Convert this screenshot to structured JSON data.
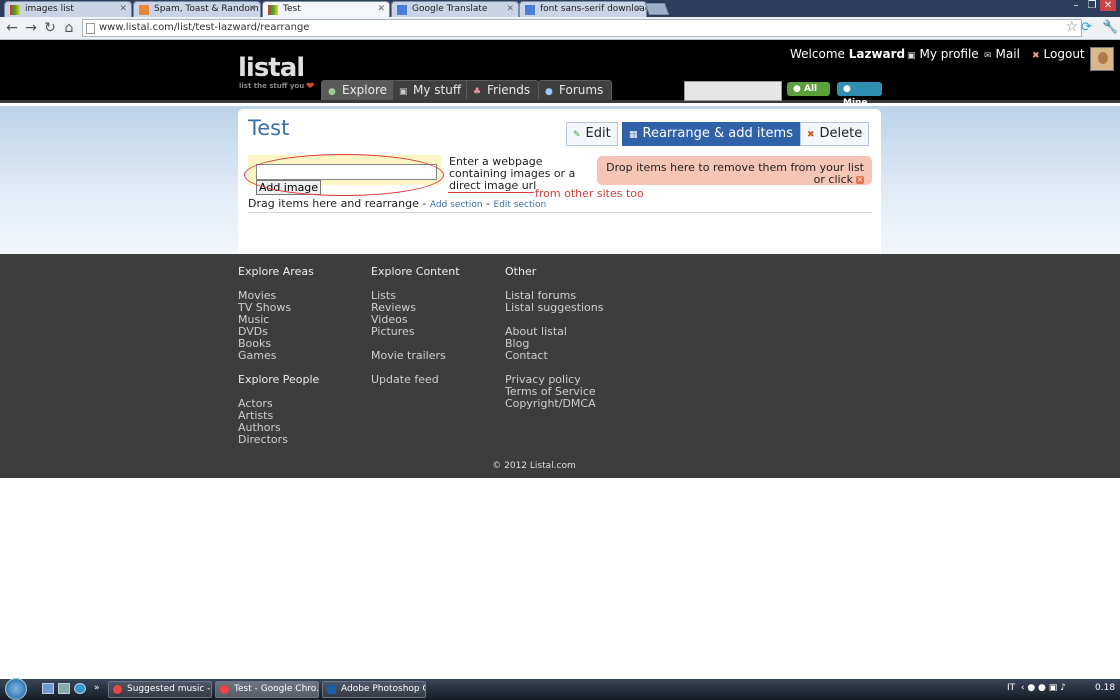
{
  "browser": {
    "tabs": [
      {
        "title": "images list",
        "active": false
      },
      {
        "title": "Spam, Toast & Random Q",
        "active": false
      },
      {
        "title": "Test",
        "active": true
      },
      {
        "title": "Google Translate",
        "active": false
      },
      {
        "title": "font sans-serif download -",
        "active": false
      }
    ],
    "url": "www.listal.com/list/test-lazward/rearrange"
  },
  "header": {
    "logo": "listal",
    "tagline": "list the stuff you",
    "nav": [
      "Explore",
      "My stuff",
      "Friends",
      "Forums"
    ],
    "welcome_prefix": "Welcome",
    "username": "Lazward",
    "links": [
      "My profile",
      "Mail",
      "Logout"
    ],
    "search_buttons": [
      "All",
      "Mine"
    ]
  },
  "list": {
    "title": "Test",
    "actions": [
      "Edit",
      "Rearrange & add items",
      "Delete"
    ],
    "add_button": "Add image",
    "hint": "Enter a webpage containing images or a direct image url",
    "annotation": "from other sites too",
    "drop_zone_text": "Drop items here to remove them from your list",
    "drop_zone_suffix": "or click",
    "drag_text": "Drag items here and rearrange -",
    "add_section": "Add section",
    "separator": "-",
    "edit_section": "Edit section"
  },
  "footer": {
    "explore_areas": {
      "heading": "Explore Areas",
      "items": [
        "Movies",
        "TV Shows",
        "Music",
        "DVDs",
        "Books",
        "Games"
      ]
    },
    "explore_people": {
      "heading": "Explore People",
      "items": [
        "Actors",
        "Artists",
        "Authors",
        "Directors"
      ]
    },
    "explore_content": {
      "heading": "Explore Content",
      "items": [
        "Lists",
        "Reviews",
        "Videos",
        "Pictures"
      ],
      "extra1": "Movie trailers",
      "extra2": "Update feed"
    },
    "other": {
      "heading": "Other",
      "group1": [
        "Listal forums",
        "Listal suggestions"
      ],
      "group2": [
        "About listal",
        "Blog",
        "Contact"
      ],
      "group3": [
        "Privacy policy",
        "Terms of Service",
        "Copyright/DMCA"
      ]
    },
    "copyright": "© 2012 Listal.com"
  },
  "taskbar": {
    "items": [
      "Suggested music - ...",
      "Test - Google Chro...",
      "Adobe Photoshop C..."
    ],
    "lang": "IT",
    "time": "0.18"
  },
  "colors": {
    "accent": "#3b6fae",
    "primary_button": "#2f62a8",
    "drop_zone": "#f6c5b6",
    "annotation": "#d9363a"
  }
}
